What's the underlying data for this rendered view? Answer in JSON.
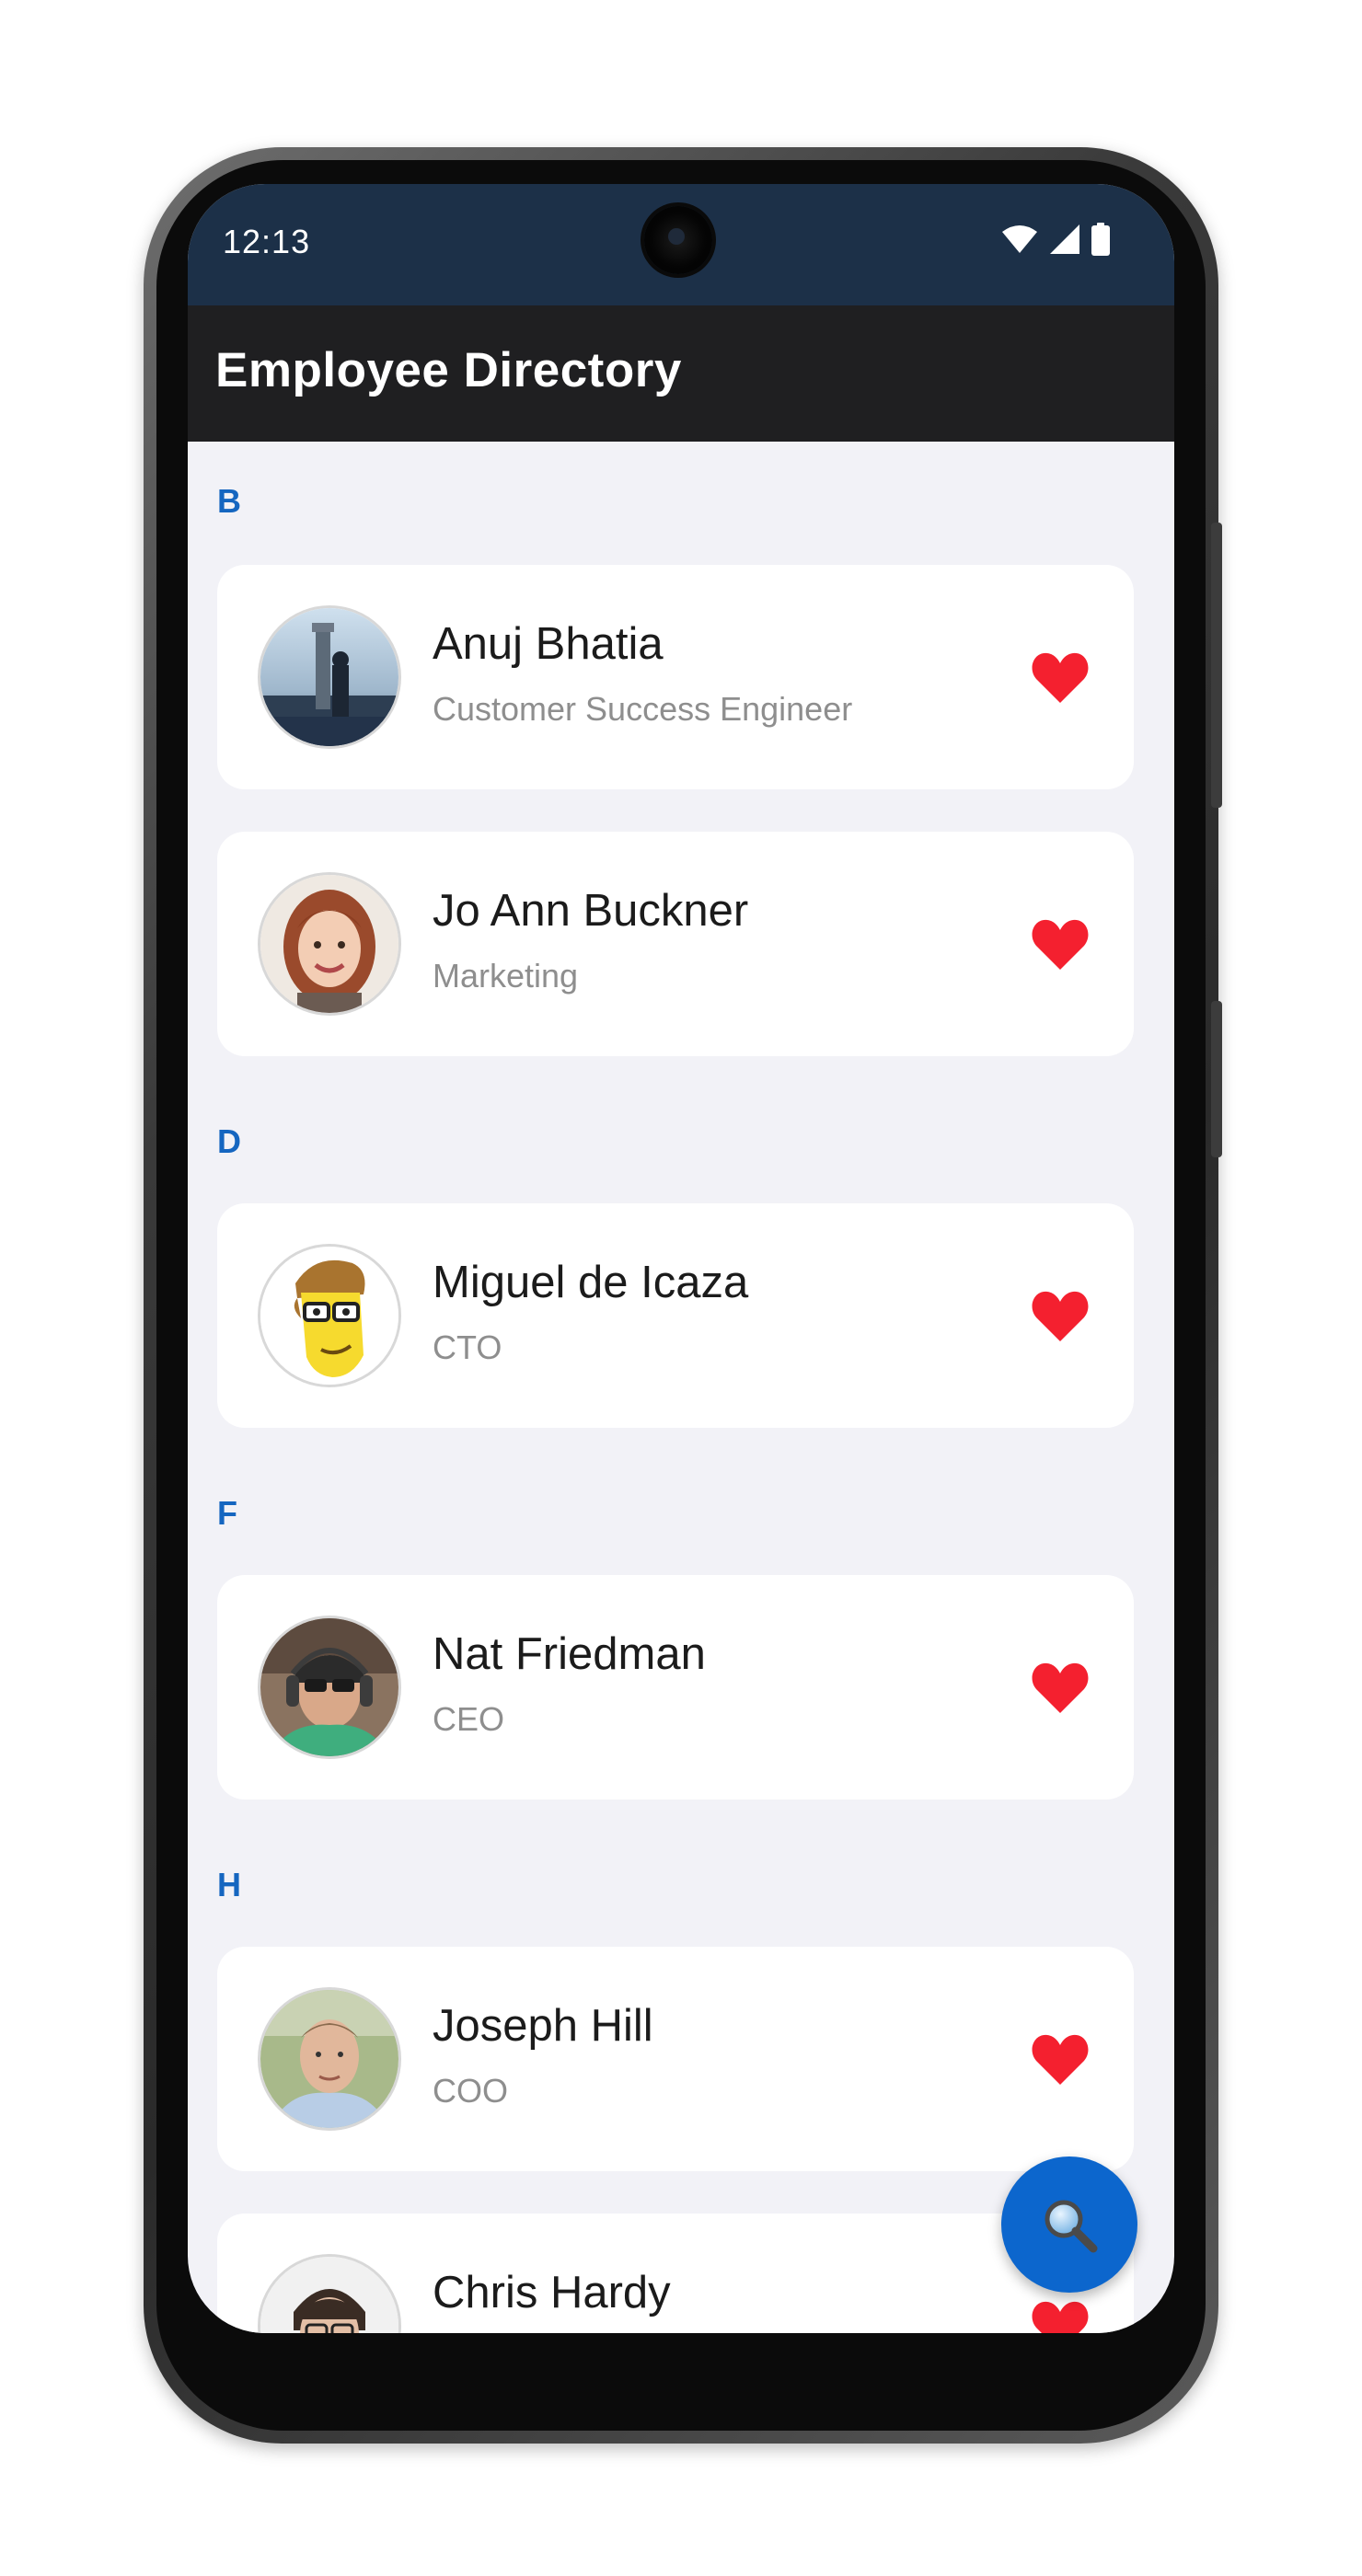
{
  "status_bar": {
    "time": "12:13",
    "icons": [
      "wifi-icon",
      "signal-icon",
      "battery-icon"
    ]
  },
  "app_bar": {
    "title": "Employee Directory"
  },
  "sections": [
    {
      "letter": "B"
    },
    {
      "letter": "D"
    },
    {
      "letter": "F"
    },
    {
      "letter": "H"
    }
  ],
  "employees": [
    {
      "name": "Anuj Bhatia",
      "role": "Customer Success Engineer",
      "favorite": true,
      "avatar": "tower-photo"
    },
    {
      "name": "Jo Ann Buckner",
      "role": "Marketing",
      "favorite": true,
      "avatar": "woman-portrait"
    },
    {
      "name": "Miguel de Icaza",
      "role": "CTO",
      "favorite": true,
      "avatar": "cartoon-portrait"
    },
    {
      "name": "Nat Friedman",
      "role": "CEO",
      "favorite": true,
      "avatar": "headset-portrait"
    },
    {
      "name": "Joseph Hill",
      "role": "COO",
      "favorite": true,
      "avatar": "man-portrait"
    },
    {
      "name": "Chris Hardy",
      "role": "",
      "favorite": true,
      "avatar": "glasses-portrait"
    }
  ],
  "fab": {
    "icon": "search-icon"
  },
  "colors": {
    "status_bar": "#1c3048",
    "app_bar": "#1f1f21",
    "section_letter": "#1566c0",
    "heart": "#f4202f",
    "fab": "#0c66cd",
    "background": "#f2f2f7"
  }
}
